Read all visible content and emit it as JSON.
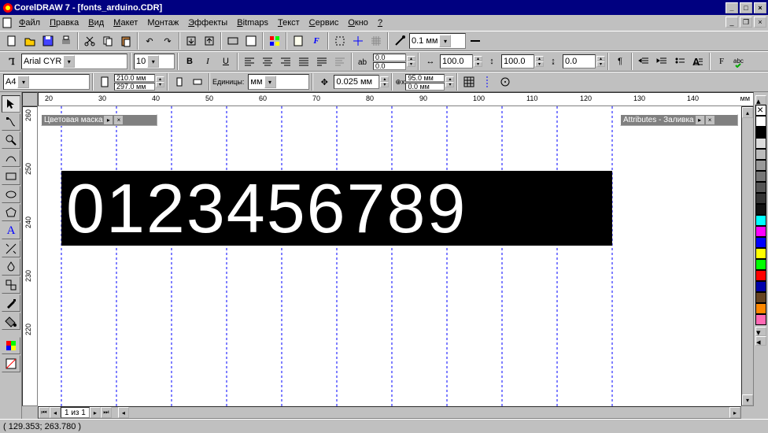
{
  "window": {
    "title": "CorelDRAW 7 - [fonts_arduino.CDR]"
  },
  "menu": {
    "file": "Файл",
    "edit": "Правка",
    "view": "Вид",
    "layout": "Макет",
    "arrange": "Монтаж",
    "effects": "Эффекты",
    "bitmaps": "Bitmaps",
    "text": "Текст",
    "tools": "Сервис",
    "window": "Окно",
    "help": "?"
  },
  "prop1": {
    "line_width": "0.1 мм"
  },
  "prop2": {
    "font": "Arial CYR",
    "size": "10",
    "kern1": "0.0",
    "kern2": "0.0",
    "scale1": "100.0",
    "scale2": "100.0",
    "other": "0.0"
  },
  "prop3": {
    "pageFormat": "A4",
    "w": "210.0 мм",
    "h": "297.0 мм",
    "units_label": "Единицы:",
    "units": "мм",
    "nudge": "0.025 мм",
    "dx": "95.0 мм",
    "dy": "0.0 мм"
  },
  "canvas": {
    "text": "0123456789"
  },
  "floater_left": {
    "title": "Цветовая маска"
  },
  "floater_right": {
    "title": "Attributes - Заливка"
  },
  "page": {
    "indicator": "1 из 1"
  },
  "ruler": {
    "unit": "мм",
    "h": [
      "20",
      "30",
      "40",
      "50",
      "60",
      "70",
      "80",
      "90",
      "100",
      "110",
      "120",
      "130",
      "140"
    ],
    "v": [
      "260",
      "250",
      "240",
      "230",
      "220"
    ]
  },
  "status": {
    "coords": "( 129.353; 263.780 )"
  },
  "palette": [
    "#ffffff",
    "#000000",
    "#dddddd",
    "#bbbbbb",
    "#999999",
    "#777777",
    "#555555",
    "#333333",
    "#111111",
    "#00ffff",
    "#ff00ff",
    "#0000ff",
    "#ffff00",
    "#00ff00",
    "#ff0000",
    "#0000aa",
    "#654321",
    "#ff8800",
    "#ff69b4"
  ]
}
